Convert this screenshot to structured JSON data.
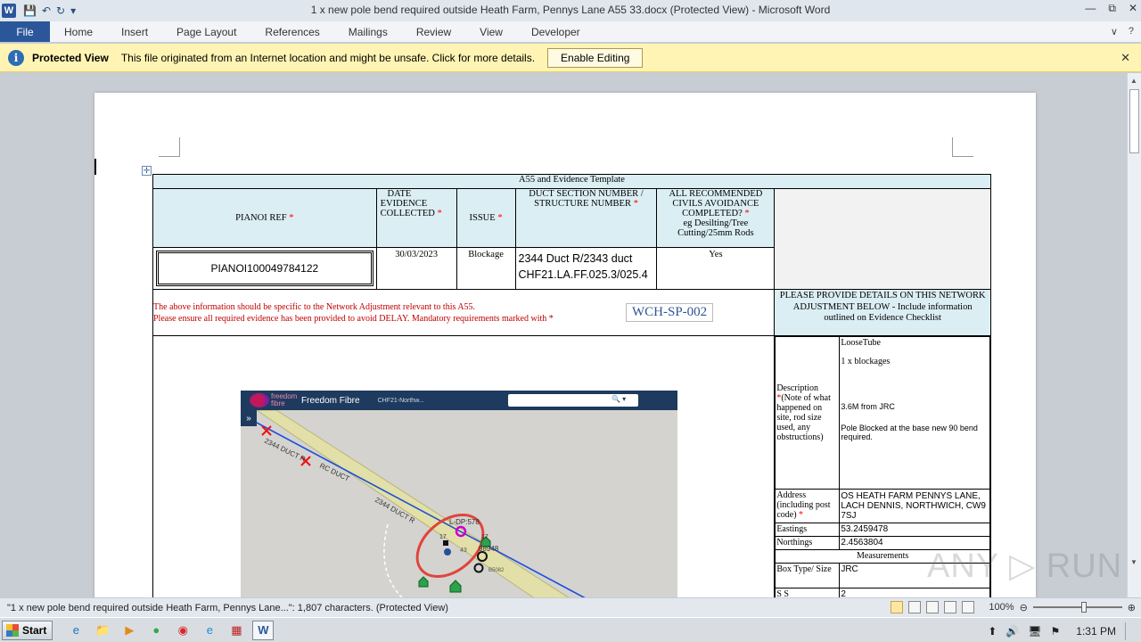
{
  "window": {
    "title": "1 x new pole bend required outside Heath Farm, Pennys Lane A55 33.docx (Protected View) - Microsoft Word",
    "app_icon": "W",
    "controls": [
      "—",
      "⧉",
      "✕"
    ]
  },
  "qat": {
    "save_icon": "💾",
    "undo_icon": "↶",
    "redo_icon": "↻",
    "more_icon": "▾"
  },
  "ribbon": {
    "file": "File",
    "tabs": [
      "Home",
      "Insert",
      "Page Layout",
      "References",
      "Mailings",
      "Review",
      "View",
      "Developer"
    ],
    "minimize_icon": "∨",
    "help_icon": "?"
  },
  "protected_view": {
    "icon": "i",
    "title": "Protected View",
    "message": "This file originated from an Internet location and might be unsafe. Click for more details.",
    "button": "Enable Editing",
    "close": "✕"
  },
  "doc": {
    "move_handle": "✛",
    "table_title": "A55 and Evidence Template",
    "headers": {
      "pianoi": "PIANOI REF",
      "date": "DATE EVIDENCE COLLECTED",
      "issue": "ISSUE",
      "duct": "DUCT SECTION NUMBER / STRUCTURE NUMBER",
      "civils": "ALL RECOMMENDED CIVILS AVOIDANCE COMPLETED?",
      "civils_sub": "eg Desilting/Tree Cutting/25mm Rods",
      "star": "*"
    },
    "values": {
      "pianoi": "PIANOI100049784122",
      "date": "30/03/2023",
      "issue": "Blockage",
      "duct_line1": "2344 Duct R/2343 duct",
      "duct_line2": "CHF21.LA.FF.025.3/025.4",
      "civils": "Yes"
    },
    "notes": {
      "line1": "The above information should be specific to the Network Adjustment relevant to this A55.",
      "line2": "Please ensure all required evidence has been provided to avoid DELAY.  Mandatory requirements marked with",
      "star": "*"
    },
    "code": "WCH-SP-002",
    "details_header": "PLEASE PROVIDE DETAILS ON THIS NETWORK ADJUSTMENT BELOW - Include information outlined on Evidence Checklist",
    "description_label": "Description",
    "description_note": "(Note of what happened on site, rod size used, any obstructions)",
    "description": {
      "l1": "LooseTube",
      "l2": "1 x blockages",
      "l3": "3.6M from JRC",
      "l4": "Pole Blocked at the base new 90 bend required."
    },
    "address_label": "Address (including post code)",
    "address": "OS HEATH FARM PENNYS LANE, LACH DENNIS, NORTHWICH, CW9 7SJ",
    "eastings_label": "Eastings",
    "eastings": "53.2459478",
    "northings_label": "Northings",
    "northings": "2.4563804",
    "measurements": "Measurements",
    "boxtype_label": "Box Type/ Size",
    "boxtype": "JRC",
    "next_label": "S  S",
    "next_value": "2"
  },
  "map": {
    "logo_text": "freedom fibre",
    "brand": "Freedom Fibre",
    "selector": "CHF21-Northw...",
    "search_icon": "🔍 ▾",
    "expand_icon": "»",
    "labels": {
      "duct_r1": "2344 DUCT R",
      "duct_r2": "2344 DUCT R",
      "rc_duct": "RC DUCT",
      "ldp": "L-DP:578",
      "c17": "17",
      "c98948": "98948",
      "c43": "43",
      "b5082": "B5082",
      "c17b": "17"
    }
  },
  "status": {
    "text": "\"1 x new pole bend required outside Heath Farm, Pennys Lane...\": 1,807 characters.  (Protected View)",
    "zoom": "100%",
    "minus": "⊖",
    "plus": "⊕"
  },
  "scroll": {
    "up": "▲",
    "down": "▼"
  },
  "taskbar": {
    "start": "Start",
    "apps": [
      "e",
      "📁",
      "▶",
      "●",
      "◉",
      "e",
      "▦",
      "W"
    ],
    "tray_icons": [
      "⬆",
      "🔊",
      "🖥",
      "⚑"
    ],
    "time": "1:31 PM"
  },
  "watermark": "ANY ▷ RUN",
  "colors": {
    "file_tab": "#2b579a",
    "protected_bar": "#fff4b3",
    "header_fill": "#dbeef4",
    "required": "#ff0000"
  }
}
